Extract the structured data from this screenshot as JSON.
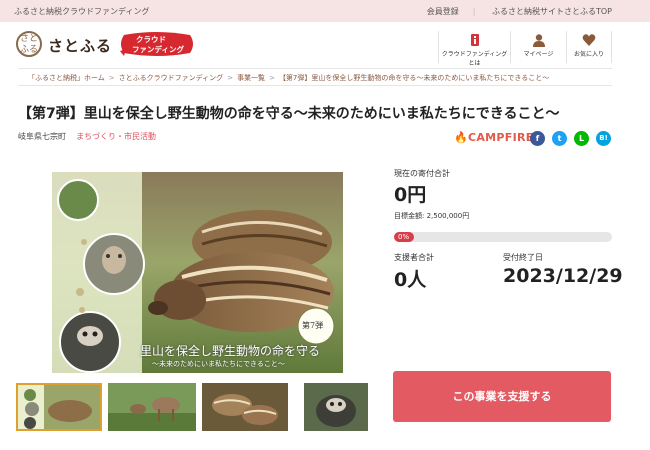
{
  "topbar": {
    "site_label": "ふるさと納税クラウドファンディング",
    "links": [
      "会員登録",
      "ふるさと納税サイトさとふるTOP"
    ]
  },
  "header": {
    "logo_mark": "さとふる",
    "logo_text": "さとふる",
    "badge_line1": "クラウド",
    "badge_line2": "ファンディング",
    "nav": [
      {
        "label": "クラウドファンディングとは",
        "icon": "info-icon"
      },
      {
        "label": "マイページ",
        "icon": "user-icon"
      },
      {
        "label": "お気に入り",
        "icon": "heart-icon"
      }
    ]
  },
  "breadcrumb": [
    "「ふるさと納税」ホーム",
    "さとふるクラウドファンディング",
    "事業一覧",
    "【第7弾】里山を保全し野生動物の命を守る～未来のためにいま私たちにできること～"
  ],
  "project": {
    "title": "【第7弾】里山を保全し野生動物の命を守る～未来のためにいま私たちにできること～",
    "location": "岐阜県七宗町",
    "category": "まちづくり・市民活動",
    "platform": "CAMPFIRE",
    "image_badge": "第7弾",
    "image_caption_main": "里山を保全し野生動物の命を守る",
    "image_caption_sub": "～未来のためにいま私たちにできること～"
  },
  "social": [
    {
      "name": "facebook",
      "glyph": "f",
      "color": "#3b5998"
    },
    {
      "name": "twitter",
      "glyph": "t",
      "color": "#1da1f2"
    },
    {
      "name": "line",
      "glyph": "L",
      "color": "#00b900"
    },
    {
      "name": "hatena",
      "glyph": "B!",
      "color": "#00a4de"
    }
  ],
  "stats": {
    "current_label": "現在の寄付合計",
    "current_value": "0円",
    "goal_label": "目標金額: 2,500,000円",
    "progress_label": "0%",
    "progress": 0,
    "supporters_label": "支援者合計",
    "supporters_value": "0人",
    "deadline_label": "受付終了日",
    "deadline_value": "2023/12/29"
  },
  "support_button": "この事業を支援する",
  "colors": {
    "accent": "#e35a62",
    "progress": "#d83e48",
    "topbar_bg": "#f6e4e4"
  }
}
